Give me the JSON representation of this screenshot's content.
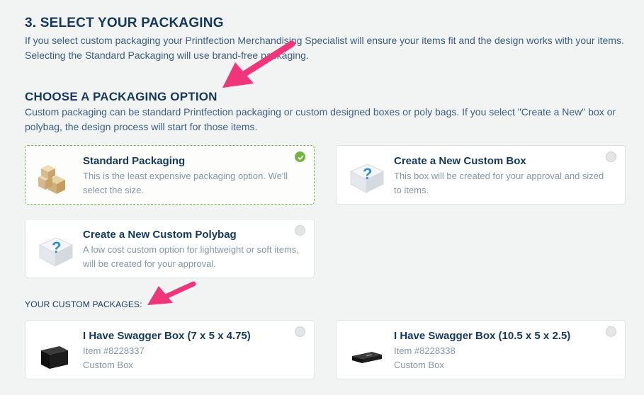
{
  "section": {
    "title": "3. SELECT YOUR PACKAGING",
    "description": "If you select custom packaging your Printfection Merchandising Specialist will ensure your items fit and the design works with your items. Selecting the Standard Packaging will use brand-free packaging."
  },
  "option_heading": {
    "title": "CHOOSE A PACKAGING OPTION",
    "description": "Custom packaging can be standard Printfection packaging or custom designed boxes or poly bags. If you select \"Create a New\" box or polybag, the design process will start for those items."
  },
  "options": [
    {
      "title": "Standard Packaging",
      "description": "This is the least expensive packaging option. We'll select the size.",
      "selected": true,
      "icon": "stacked-boxes-icon"
    },
    {
      "title": "Create a New Custom Box",
      "description": "This box will be created for your approval and sized to items.",
      "selected": false,
      "icon": "question-box-icon"
    },
    {
      "title": "Create a New Custom Polybag",
      "description": "A low cost custom option for lightweight or soft items, will be created for your approval.",
      "selected": false,
      "icon": "question-box-icon"
    }
  ],
  "custom_packages": {
    "label": "YOUR CUSTOM PACKAGES:",
    "items": [
      {
        "title": "I Have Swagger Box (7 x 5 x 4.75)",
        "item_number": "Item #8228337",
        "type": "Custom Box",
        "selected": false,
        "icon": "black-box-icon"
      },
      {
        "title": "I Have Swagger Box (10.5 x 5 x 2.5)",
        "item_number": "Item #8228338",
        "type": "Custom Box",
        "selected": false,
        "icon": "black-flat-box-icon"
      }
    ]
  },
  "colors": {
    "heading": "#14395c",
    "body_text": "#3a5f84",
    "selected_border": "#6fb63f",
    "annotation_arrow": "#f0357a"
  }
}
